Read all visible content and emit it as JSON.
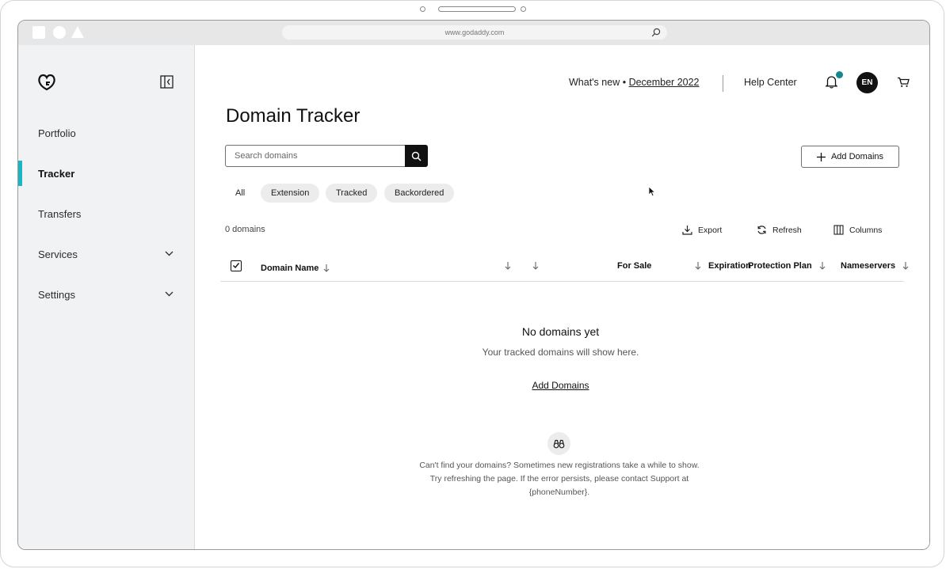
{
  "browser": {
    "url": "www.godaddy.com"
  },
  "sidebar": {
    "items": [
      {
        "label": "Portfolio"
      },
      {
        "label": "Tracker"
      },
      {
        "label": "Transfers"
      },
      {
        "label": "Services"
      },
      {
        "label": "Settings"
      }
    ],
    "active": "Tracker",
    "accent": "#1bb5c4"
  },
  "header": {
    "whats_new": "What's new •",
    "release": "December 2022",
    "help": "Help Center",
    "avatar": "EN",
    "notification_dot_color": "#12878f"
  },
  "page": {
    "title": "Domain Tracker",
    "search_placeholder": "Search domains",
    "add_button": "Add Domains",
    "filters": [
      "All",
      "Extension",
      "Tracked",
      "Backordered"
    ],
    "count": "0 domains",
    "actions": {
      "export": "Export",
      "refresh": "Refresh",
      "columns": "Columns"
    }
  },
  "table": {
    "columns": [
      "Domain Name",
      "For Sale",
      "Expiration",
      "Protection Plan",
      "Nameservers"
    ]
  },
  "empty": {
    "title": "No domains yet",
    "subtitle": "Your tracked domains will show here.",
    "link": "Add Domains",
    "note": "Can't find your domains? Sometimes new registrations take a while to show. Try refreshing the page. If the error persists, please contact Support at {phoneNumber}."
  }
}
